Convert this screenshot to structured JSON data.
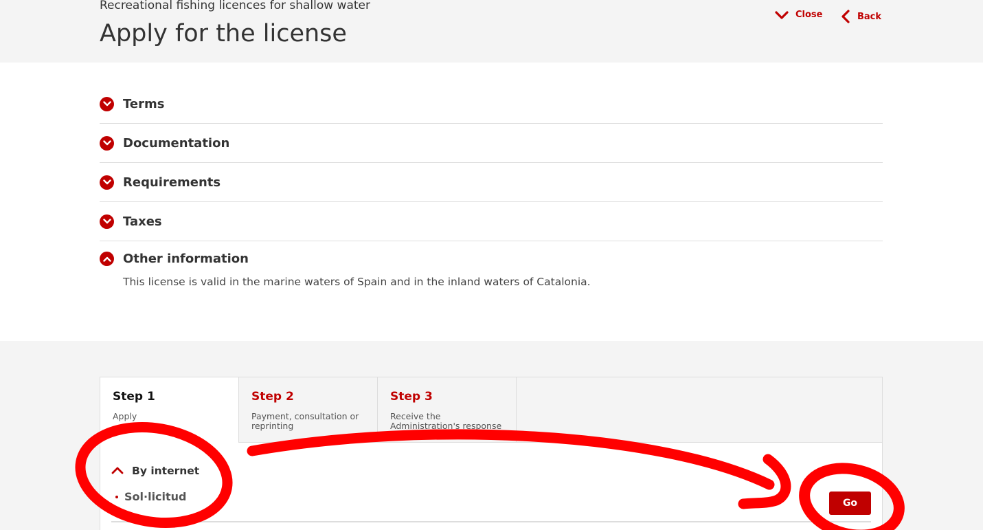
{
  "header": {
    "subtitle": "Recreational fishing licences for shallow water",
    "title": "Apply for the license",
    "close_label": "Close",
    "back_label": "Back"
  },
  "accordion": {
    "items": [
      {
        "label": "Terms",
        "state": "collapsed"
      },
      {
        "label": "Documentation",
        "state": "collapsed"
      },
      {
        "label": "Requirements",
        "state": "collapsed"
      },
      {
        "label": "Taxes",
        "state": "collapsed"
      },
      {
        "label": "Other information",
        "state": "expanded",
        "body": "This license is valid in the marine waters of Spain and in the inland waters of Catalonia."
      }
    ]
  },
  "steps": {
    "tabs": [
      {
        "title": "Step 1",
        "desc": "Apply",
        "active": true
      },
      {
        "title": "Step 2",
        "desc": "Payment, consultation or reprinting",
        "active": false
      },
      {
        "title": "Step 3",
        "desc": "Receive the Administration's response",
        "active": false
      }
    ],
    "method_label": "By internet",
    "method_item": "Sol·licitud",
    "go_label": "Go"
  },
  "colors": {
    "accent": "#c00000",
    "header_bg": "#f4f4f4",
    "annotation": "#ff0000"
  },
  "icons": {
    "close": "chevron-down-icon",
    "back": "chevron-left-icon",
    "collapsed": "chevron-down-circle-icon",
    "expanded": "chevron-up-circle-icon",
    "method": "chevron-up-icon"
  }
}
